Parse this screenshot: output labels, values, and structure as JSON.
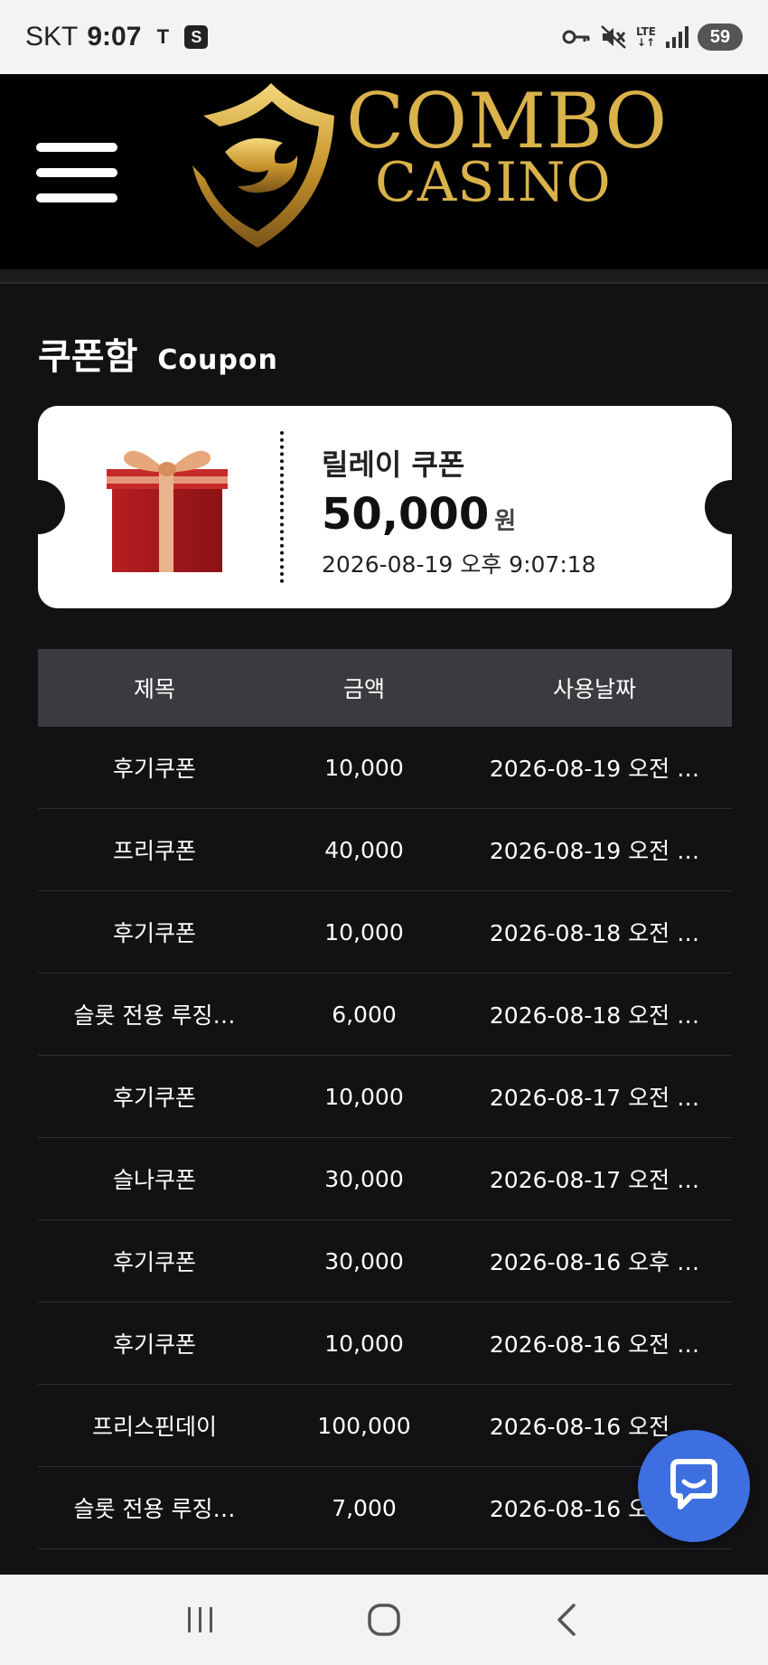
{
  "status_bar": {
    "carrier": "SKT",
    "time": "9:07",
    "network": "LTE",
    "battery": "59"
  },
  "header": {
    "logo_line1": "COMBO",
    "logo_line2": "CASINO"
  },
  "page": {
    "title": "쿠폰함",
    "subtitle": "Coupon"
  },
  "featured_coupon": {
    "name": "릴레이 쿠폰",
    "amount": "50,000",
    "unit": "원",
    "date": "2026-08-19 오후 9:07:18"
  },
  "table": {
    "headers": [
      "제목",
      "금액",
      "사용날짜"
    ],
    "rows": [
      {
        "title": "후기쿠폰",
        "amount": "10,000",
        "date": "2026-08-19 오전 …"
      },
      {
        "title": "프리쿠폰",
        "amount": "40,000",
        "date": "2026-08-19 오전 …"
      },
      {
        "title": "후기쿠폰",
        "amount": "10,000",
        "date": "2026-08-18 오전 …"
      },
      {
        "title": "슬롯 전용 루징…",
        "amount": "6,000",
        "date": "2026-08-18 오전 …"
      },
      {
        "title": "후기쿠폰",
        "amount": "10,000",
        "date": "2026-08-17 오전 …"
      },
      {
        "title": "슬나쿠폰",
        "amount": "30,000",
        "date": "2026-08-17 오전 …"
      },
      {
        "title": "후기쿠폰",
        "amount": "30,000",
        "date": "2026-08-16 오후 …"
      },
      {
        "title": "후기쿠폰",
        "amount": "10,000",
        "date": "2026-08-16 오전 …"
      },
      {
        "title": "프리스핀데이",
        "amount": "100,000",
        "date": "2026-08-16 오전 …"
      },
      {
        "title": "슬롯 전용 루징…",
        "amount": "7,000",
        "date": "2026-08-16 오전 …"
      }
    ]
  },
  "colors": {
    "background": "#121114",
    "header": "#000000",
    "gold": "#d9b24a",
    "table_head": "#3b3b3f",
    "fab": "#3d6fe0"
  },
  "icons": {
    "menu": "hamburger-icon",
    "chat": "chat-bubble-icon",
    "nav": [
      "recent-apps-icon",
      "home-icon",
      "back-icon"
    ]
  }
}
